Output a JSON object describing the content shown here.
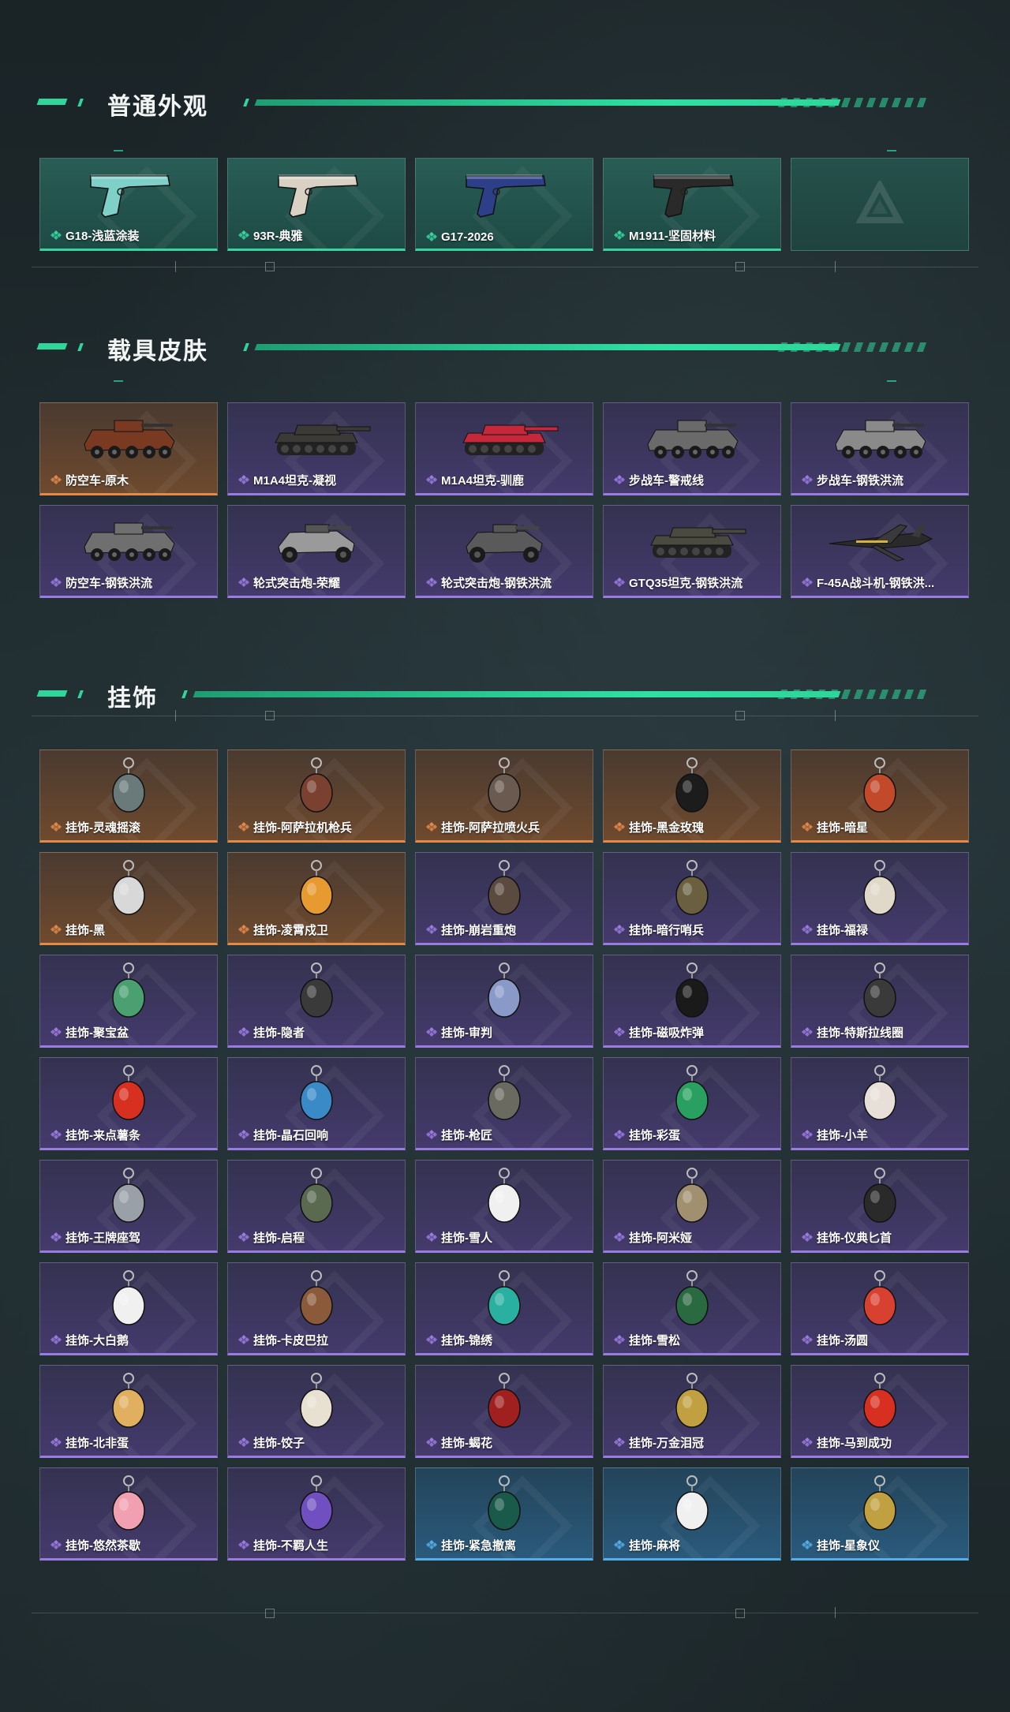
{
  "sections": {
    "guns": {
      "title": "普通外观",
      "items": [
        {
          "label": "G18-浅蓝涂装",
          "rarity": "green",
          "icon": "pistol-icon",
          "color": "#7fd0c8"
        },
        {
          "label": "93R-典雅",
          "rarity": "green",
          "icon": "pistol-icon",
          "color": "#d9d2c4"
        },
        {
          "label": "G17-2026",
          "rarity": "green",
          "icon": "pistol-icon",
          "color": "#2e3f8a"
        },
        {
          "label": "M1911-坚固材料",
          "rarity": "green",
          "icon": "pistol-icon",
          "color": "#2a2a2a"
        }
      ]
    },
    "vehicles": {
      "title": "载具皮肤",
      "items": [
        {
          "label": "防空车-原木",
          "rarity": "orange",
          "icon": "apc-icon",
          "color": "#7a3a22"
        },
        {
          "label": "M1A4坦克-凝视",
          "rarity": "purple",
          "icon": "tank-icon",
          "color": "#3c3a36"
        },
        {
          "label": "M1A4坦克-驯鹿",
          "rarity": "purple",
          "icon": "tank-icon",
          "color": "#c5283a"
        },
        {
          "label": "步战车-警戒线",
          "rarity": "purple",
          "icon": "apc-icon",
          "color": "#6a6a6a"
        },
        {
          "label": "步战车-钢铁洪流",
          "rarity": "purple",
          "icon": "apc-icon",
          "color": "#8a8a8a"
        },
        {
          "label": "防空车-钢铁洪流",
          "rarity": "purple",
          "icon": "apc-icon",
          "color": "#6f6f6f"
        },
        {
          "label": "轮式突击炮-荣耀",
          "rarity": "purple",
          "icon": "buggy-icon",
          "color": "#9a9a9a"
        },
        {
          "label": "轮式突击炮-钢铁洪流",
          "rarity": "purple",
          "icon": "buggy-icon",
          "color": "#5a5a5a"
        },
        {
          "label": "GTQ35坦克-钢铁洪流",
          "rarity": "purple",
          "icon": "tank-icon",
          "color": "#4a4a40"
        },
        {
          "label": "F-45A战斗机-钢铁洪...",
          "rarity": "purple",
          "icon": "jet-icon",
          "color": "#2a2a2a"
        }
      ]
    },
    "charms": {
      "title": "挂饰",
      "items": [
        {
          "label": "挂饰-灵魂摇滚",
          "rarity": "orange",
          "color": "#6a7a7a"
        },
        {
          "label": "挂饰-阿萨拉机枪兵",
          "rarity": "orange",
          "color": "#7a4030"
        },
        {
          "label": "挂饰-阿萨拉喷火兵",
          "rarity": "orange",
          "color": "#6a5a50"
        },
        {
          "label": "挂饰-黑金玫瑰",
          "rarity": "orange",
          "color": "#1c1c1c"
        },
        {
          "label": "挂饰-暗星",
          "rarity": "orange",
          "color": "#c24a2a"
        },
        {
          "label": "挂饰-黑",
          "rarity": "orange",
          "color": "#d8d8d8"
        },
        {
          "label": "挂饰-凌霄戍卫",
          "rarity": "orange",
          "color": "#e69a30"
        },
        {
          "label": "挂饰-崩岩重炮",
          "rarity": "purple",
          "color": "#5a4a40"
        },
        {
          "label": "挂饰-暗行哨兵",
          "rarity": "purple",
          "color": "#6a6040"
        },
        {
          "label": "挂饰-福禄",
          "rarity": "purple",
          "color": "#e0d8c8"
        },
        {
          "label": "挂饰-聚宝盆",
          "rarity": "purple",
          "color": "#4aa070"
        },
        {
          "label": "挂饰-隐者",
          "rarity": "purple",
          "color": "#3a3a3a"
        },
        {
          "label": "挂饰-审判",
          "rarity": "purple",
          "color": "#8a9ac8"
        },
        {
          "label": "挂饰-磁吸炸弹",
          "rarity": "purple",
          "color": "#1a1a1a"
        },
        {
          "label": "挂饰-特斯拉线圈",
          "rarity": "purple",
          "color": "#3a3a3a"
        },
        {
          "label": "挂饰-来点薯条",
          "rarity": "purple",
          "color": "#d83020"
        },
        {
          "label": "挂饰-晶石回响",
          "rarity": "purple",
          "color": "#3a8ac8"
        },
        {
          "label": "挂饰-枪匠",
          "rarity": "purple",
          "color": "#6a6a60"
        },
        {
          "label": "挂饰-彩蛋",
          "rarity": "purple",
          "color": "#2aa060"
        },
        {
          "label": "挂饰-小羊",
          "rarity": "purple",
          "color": "#e8e0d8"
        },
        {
          "label": "挂饰-王牌座驾",
          "rarity": "purple",
          "color": "#9aa0a8"
        },
        {
          "label": "挂饰-启程",
          "rarity": "purple",
          "color": "#5a6a50"
        },
        {
          "label": "挂饰-雪人",
          "rarity": "purple",
          "color": "#f0f0f0"
        },
        {
          "label": "挂饰-阿米娅",
          "rarity": "purple",
          "color": "#a09070"
        },
        {
          "label": "挂饰-仪典匕首",
          "rarity": "purple",
          "color": "#2a2a2a"
        },
        {
          "label": "挂饰-大白鹅",
          "rarity": "purple",
          "color": "#f0f0f0"
        },
        {
          "label": "挂饰-卡皮巴拉",
          "rarity": "purple",
          "color": "#8a5a3a"
        },
        {
          "label": "挂饰-锦绣",
          "rarity": "purple",
          "color": "#2ab0a0"
        },
        {
          "label": "挂饰-雪松",
          "rarity": "purple",
          "color": "#2a6a40"
        },
        {
          "label": "挂饰-汤圆",
          "rarity": "purple",
          "color": "#d84030"
        },
        {
          "label": "挂饰-北非蛋",
          "rarity": "purple",
          "color": "#e0b060"
        },
        {
          "label": "挂饰-饺子",
          "rarity": "purple",
          "color": "#e8e0d0"
        },
        {
          "label": "挂饰-蝎花",
          "rarity": "purple",
          "color": "#a02020"
        },
        {
          "label": "挂饰-万金泪冠",
          "rarity": "purple",
          "color": "#c0a040"
        },
        {
          "label": "挂饰-马到成功",
          "rarity": "purple",
          "color": "#d83020"
        },
        {
          "label": "挂饰-悠然茶歇",
          "rarity": "purple",
          "color": "#f0a0b0"
        },
        {
          "label": "挂饰-不羁人生",
          "rarity": "purple",
          "color": "#7050c0"
        },
        {
          "label": "挂饰-紧急撤离",
          "rarity": "blue",
          "color": "#1a5a4a"
        },
        {
          "label": "挂饰-麻将",
          "rarity": "blue",
          "color": "#f0f0f0"
        },
        {
          "label": "挂饰-星象仪",
          "rarity": "blue",
          "color": "#c0a040"
        }
      ]
    }
  },
  "colors": {
    "accent": "#2fd69a",
    "green": "#37d6a0",
    "orange": "#e3894a",
    "purple": "#9a7be0",
    "blue": "#55aee8"
  }
}
